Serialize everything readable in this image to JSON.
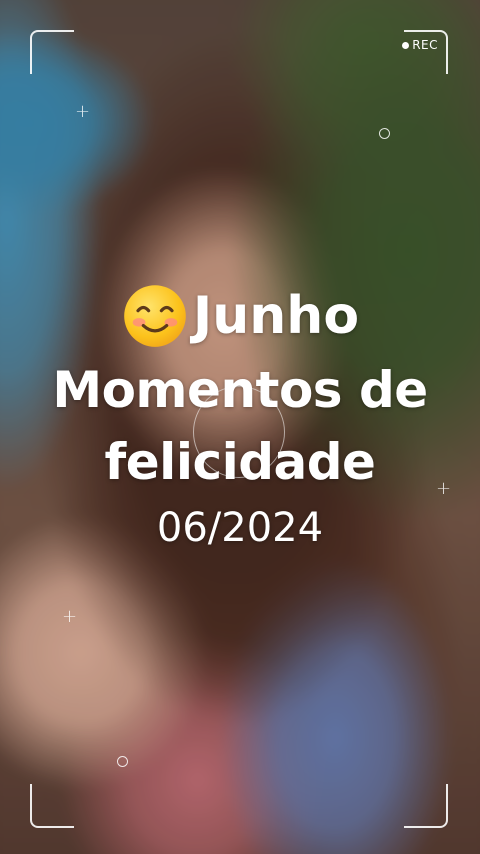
{
  "recorder": {
    "rec_label": "REC"
  },
  "caption": {
    "month": "Junho",
    "title_line1": "Momentos de",
    "title_line2": "felicidade",
    "date": "06/2024",
    "emoji_icon": "smiling-face-icon"
  },
  "colors": {
    "text": "#ffffff",
    "frame": "#ffffff"
  }
}
